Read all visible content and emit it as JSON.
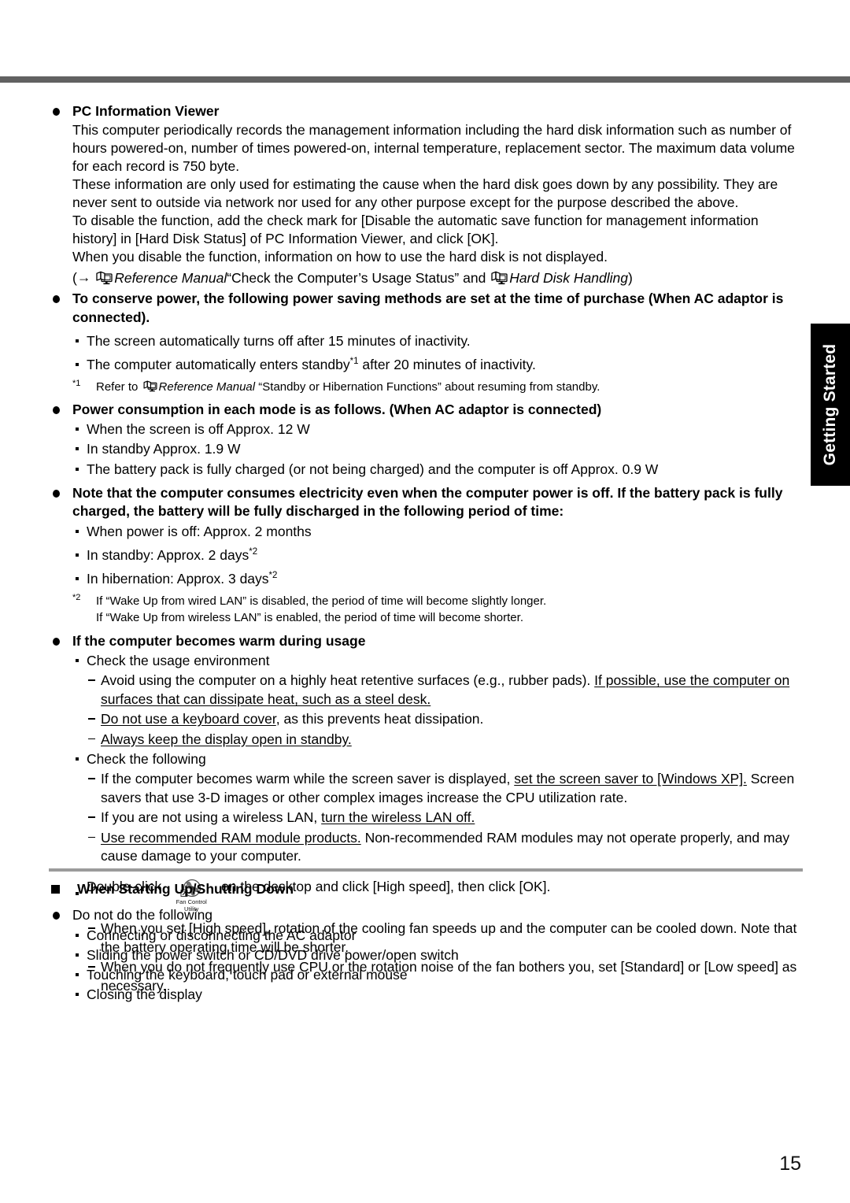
{
  "document": {
    "page_number": "15",
    "side_tab_label": "Getting Started"
  },
  "sections": {
    "pc_info_viewer": {
      "heading": "PC Information Viewer",
      "para1": "This computer periodically records the management information including the hard disk information such as number of hours powered-on, number of times powered-on, internal temperature, replacement sector. The maximum data volume for each record is 750 byte.",
      "para2": "These information are only used for estimating the cause when the hard disk goes down by any possibility. They are never sent to outside via network nor used for any other purpose except for the purpose described the above.",
      "para3": "To disable the function, add the check mark for [Disable the automatic save function for management information history] in [Hard Disk Status] of PC Information Viewer, and click [OK].",
      "para4": "When you disable the function, information on how to use the hard disk is not displayed.",
      "reference_line": {
        "open_paren": "(",
        "arrow": "→",
        "manual_title": "Reference Manual",
        "topic1": "“Check the Computer’s Usage Status”",
        "conjunction": "and",
        "topic2": "Hard Disk Handling",
        "close_paren": ")"
      }
    },
    "conserve_power": {
      "heading": "To conserve power, the following power saving methods are set at the time of purchase (When AC adaptor is connected).",
      "items": [
        "The screen automatically turns off after 15 minutes of inactivity.",
        "The computer automatically enters standby"
      ],
      "item2_suffix": " after 20 minutes of inactivity.",
      "item2_note": "*1",
      "footnote": {
        "mark": "*1",
        "prefix": "Refer to",
        "manual_title": "Reference Manual",
        "suffix": "“Standby or Hibernation Functions” about resuming from standby."
      }
    },
    "power_consumption": {
      "heading": "Power consumption in each mode is as follows. (When AC adaptor is connected)",
      "items": [
        "When the screen is off Approx. 12 W",
        "In standby Approx. 1.9 W",
        "The battery pack is fully charged (or not being charged) and the computer is off Approx. 0.9 W"
      ]
    },
    "discharge_note": {
      "heading": "Note that the computer consumes electricity even when the computer power is off. If the battery pack is fully charged, the battery will be fully discharged in the following period of time:",
      "item1": "When power is off: Approx. 2 months",
      "item2": "In standby: Approx. 2 days",
      "item2_note": "*2",
      "item3": "In hibernation: Approx. 3 days",
      "item3_note": "*2",
      "footnote": {
        "mark": "*2",
        "line1": "If “Wake Up from wired LAN” is disabled, the period of time will become slightly longer.",
        "line2": "If “Wake Up from wireless LAN” is enabled, the period of time will become shorter."
      }
    },
    "computer_warm": {
      "heading": "If the computer becomes warm during usage",
      "check_environment": {
        "label": "Check the usage environment",
        "items": [
          {
            "plain1": "Avoid using the computer on a highly heat retentive surfaces (e.g., rubber pads). ",
            "underlined": "If possible, use the computer on surfaces that can dissipate heat, such as a steel desk.",
            "plain2": ""
          },
          {
            "plain1": "",
            "underlined": "Do not use a keyboard cover",
            "plain2": ", as this prevents heat dissipation."
          },
          {
            "plain1": "",
            "underlined": "Always keep the display open in standby.",
            "plain2": ""
          }
        ]
      },
      "check_following": {
        "label": "Check the following",
        "items": [
          {
            "plain1": "If the computer becomes warm while the screen saver is displayed, ",
            "underlined": "set the screen saver to [Windows XP].",
            "plain2": " Screen savers that use 3-D images or other complex images increase the CPU utilization rate."
          },
          {
            "plain1": "If you are not using a wireless LAN, ",
            "underlined": "turn the wireless LAN off.",
            "plain2": ""
          },
          {
            "plain1": "",
            "underlined": "Use recommended RAM module products.",
            "plain2": " Non-recommended RAM modules may not operate properly, and may cause damage to your computer."
          }
        ]
      },
      "fan_control": {
        "prefix": "Double-click",
        "icon_caption_line1": "Fan Control",
        "icon_caption_line2": "Utility",
        "suffix": "on the desktop and click [High speed], then click [OK].",
        "notes": [
          "When you set [High speed], rotation of the cooling fan speeds up and the computer can be cooled down. Note that the battery operating time will be shorter.",
          "When you do not frequently use CPU or the rotation noise of the fan bothers you, set [Standard] or [Low speed] as necessary."
        ]
      }
    },
    "starting_up": {
      "heading": "When Starting Up/Shutting Down",
      "subheading": "Do not do the following",
      "items": [
        "Connecting or disconnecting the AC adaptor",
        "Sliding the power switch or CD/DVD drive power/open switch",
        "Touching the keyboard, touch pad or external mouse",
        "Closing the display"
      ]
    }
  }
}
